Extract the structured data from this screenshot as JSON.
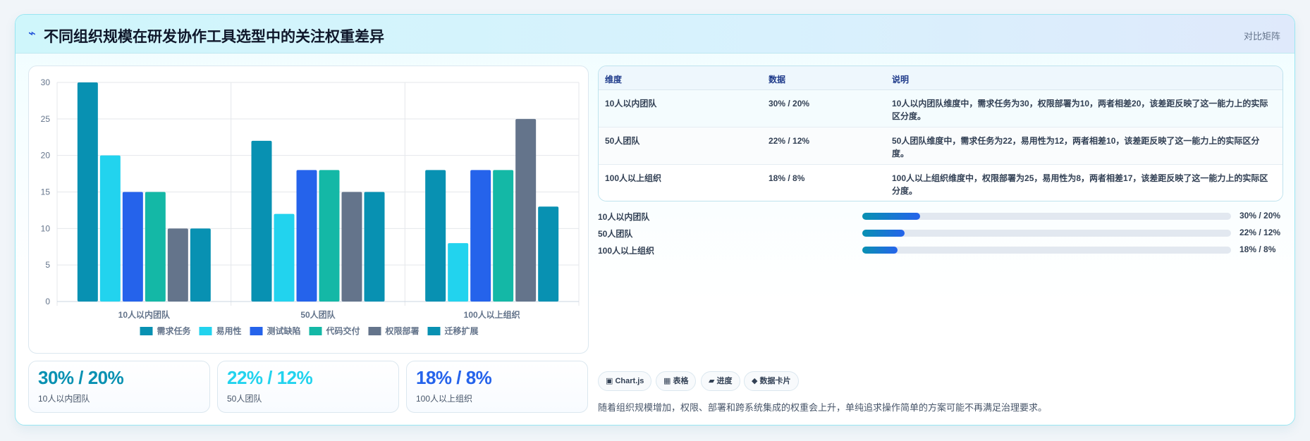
{
  "header": {
    "icon": "⌁",
    "title": "不同组织规模在研发协作工具选型中的关注权重差异",
    "tag": "对比矩阵"
  },
  "colors": {
    "accent": "#0891b2",
    "kpi": [
      "#0891b2",
      "#22d3ee",
      "#2563eb"
    ]
  },
  "chart_data": {
    "type": "bar",
    "categories": [
      "10人以内团队",
      "50人团队",
      "100人以上组织"
    ],
    "series": [
      {
        "name": "需求任务",
        "color": "#0891b2",
        "values": [
          30,
          22,
          18
        ]
      },
      {
        "name": "易用性",
        "color": "#22d3ee",
        "values": [
          20,
          12,
          8
        ]
      },
      {
        "name": "测试缺陷",
        "color": "#2563eb",
        "values": [
          15,
          18,
          18
        ]
      },
      {
        "name": "代码交付",
        "color": "#14b8a6",
        "values": [
          15,
          18,
          18
        ]
      },
      {
        "name": "权限部署",
        "color": "#64748b",
        "values": [
          10,
          15,
          25
        ]
      },
      {
        "name": "迁移扩展",
        "color": "#0891b2",
        "values": [
          10,
          15,
          13
        ]
      }
    ],
    "ylim": [
      0,
      30
    ],
    "yticks": [
      0,
      5,
      10,
      15,
      20,
      25,
      30
    ],
    "grid": true,
    "legend": "bottom"
  },
  "table": {
    "headers": [
      "维度",
      "数据",
      "说明"
    ],
    "rows": [
      {
        "dim": "10人以内团队",
        "data": "30% / 20%",
        "desc": "10人以内团队维度中，需求任务为30，权限部署为10，两者相差20，该差距反映了这一能力上的实际区分度。"
      },
      {
        "dim": "50人团队",
        "data": "22% / 12%",
        "desc": "50人团队维度中，需求任务为22，易用性为12，两者相差10，该差距反映了这一能力上的实际区分度。"
      },
      {
        "dim": "100人以上组织",
        "data": "18% / 8%",
        "desc": "100人以上组织维度中，权限部署为25，易用性为8，两者相差17，该差距反映了这一能力上的实际区分度。"
      }
    ]
  },
  "progress": [
    {
      "label": "10人以内团队",
      "value": "30% / 20%",
      "fraction": 0.157
    },
    {
      "label": "50人团队",
      "value": "22% / 12%",
      "fraction": 0.115
    },
    {
      "label": "100人以上组织",
      "value": "18% / 8%",
      "fraction": 0.095
    }
  ],
  "kpis": [
    {
      "value": "30% / 20%",
      "label": "10人以内团队"
    },
    {
      "value": "22% / 12%",
      "label": "50人团队"
    },
    {
      "value": "18% / 8%",
      "label": "100人以上组织"
    }
  ],
  "chips": [
    {
      "icon": "▣",
      "label": "Chart.js"
    },
    {
      "icon": "▦",
      "label": "表格"
    },
    {
      "icon": "▰",
      "label": "进度"
    },
    {
      "icon": "◆",
      "label": "数据卡片"
    }
  ],
  "footnote": "随着组织规模增加，权限、部署和跨系统集成的权重会上升，单纯追求操作简单的方案可能不再满足治理要求。"
}
